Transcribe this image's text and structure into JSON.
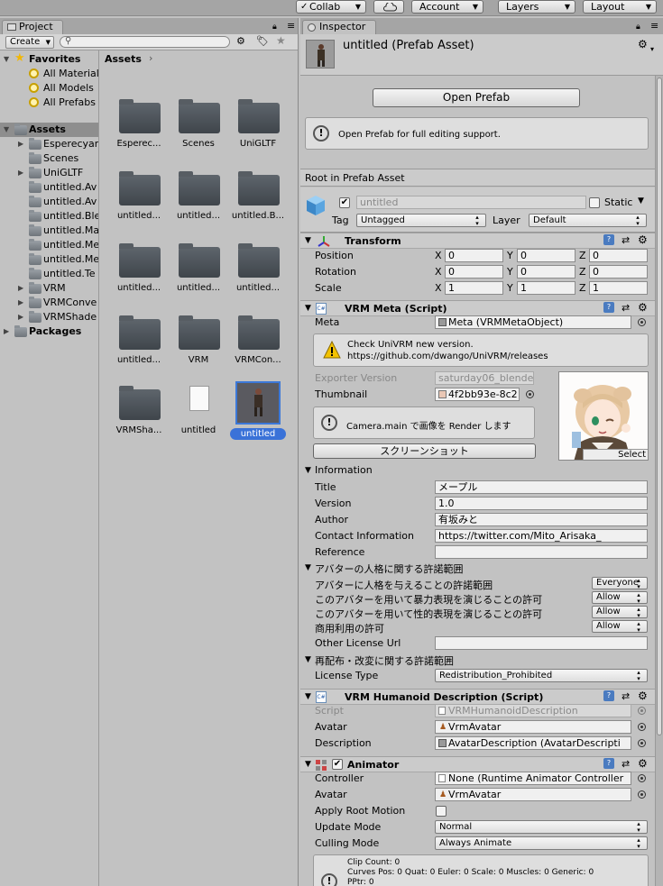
{
  "toolbar": {
    "collab": "Collab",
    "account": "Account",
    "layers": "Layers",
    "layout": "Layout"
  },
  "project": {
    "tab": "Project",
    "create": "Create",
    "breadcrumb": "Assets",
    "tree": [
      {
        "label": "Favorites",
        "bold": true,
        "level": 0,
        "icon": "star"
      },
      {
        "label": "All Materials",
        "level": 1,
        "icon": "search"
      },
      {
        "label": "All Models",
        "level": 1,
        "icon": "search"
      },
      {
        "label": "All Prefabs",
        "level": 1,
        "icon": "search"
      },
      {
        "label": "",
        "level": -1
      },
      {
        "label": "Assets",
        "bold": true,
        "level": 0,
        "icon": "folder",
        "selected": true
      },
      {
        "label": "Esperecyan",
        "level": 1,
        "icon": "folder",
        "arrow": true
      },
      {
        "label": "Scenes",
        "level": 1,
        "icon": "folder"
      },
      {
        "label": "UniGLTF",
        "level": 1,
        "icon": "folder",
        "arrow": true
      },
      {
        "label": "untitled.Av",
        "level": 1,
        "icon": "folder"
      },
      {
        "label": "untitled.Av",
        "level": 1,
        "icon": "folder"
      },
      {
        "label": "untitled.Ble",
        "level": 1,
        "icon": "folder"
      },
      {
        "label": "untitled.Ma",
        "level": 1,
        "icon": "folder"
      },
      {
        "label": "untitled.Me",
        "level": 1,
        "icon": "folder"
      },
      {
        "label": "untitled.Me",
        "level": 1,
        "icon": "folder"
      },
      {
        "label": "untitled.Te",
        "level": 1,
        "icon": "folder"
      },
      {
        "label": "VRM",
        "level": 1,
        "icon": "folder",
        "arrow": true
      },
      {
        "label": "VRMConve",
        "level": 1,
        "icon": "folder",
        "arrow": true
      },
      {
        "label": "VRMShade",
        "level": 1,
        "icon": "folder",
        "arrow": true
      },
      {
        "label": "Packages",
        "bold": true,
        "level": 0,
        "icon": "folder",
        "arrow": true
      }
    ],
    "grid": [
      {
        "label": "Esperec...",
        "type": "folder"
      },
      {
        "label": "Scenes",
        "type": "folder"
      },
      {
        "label": "UniGLTF",
        "type": "folder"
      },
      {
        "label": "untitled...",
        "type": "folder"
      },
      {
        "label": "untitled...",
        "type": "folder"
      },
      {
        "label": "untitled.B...",
        "type": "folder"
      },
      {
        "label": "untitled...",
        "type": "folder"
      },
      {
        "label": "untitled...",
        "type": "folder"
      },
      {
        "label": "untitled...",
        "type": "folder"
      },
      {
        "label": "untitled...",
        "type": "folder"
      },
      {
        "label": "VRM",
        "type": "folder"
      },
      {
        "label": "VRMCon...",
        "type": "folder"
      },
      {
        "label": "VRMSha...",
        "type": "folder"
      },
      {
        "label": "untitled",
        "type": "file"
      },
      {
        "label": "untitled",
        "type": "prefab",
        "selected": true
      }
    ]
  },
  "inspector": {
    "tab": "Inspector",
    "title": "untitled (Prefab Asset)",
    "open_prefab": "Open Prefab",
    "open_prefab_help": "Open Prefab for full editing support.",
    "root_label": "Root in Prefab Asset",
    "go_name": "untitled",
    "static": "Static",
    "tag_label": "Tag",
    "tag_value": "Untagged",
    "layer_label": "Layer",
    "layer_value": "Default",
    "transform": {
      "title": "Transform",
      "rows": [
        {
          "label": "Position",
          "x": "0",
          "y": "0",
          "z": "0"
        },
        {
          "label": "Rotation",
          "x": "0",
          "y": "0",
          "z": "0"
        },
        {
          "label": "Scale",
          "x": "1",
          "y": "1",
          "z": "1"
        }
      ]
    },
    "vrm_meta": {
      "title": "VRM Meta (Script)",
      "meta_label": "Meta",
      "meta_value": "Meta (VRMMetaObject)",
      "warning_line1": "Check UniVRM new version.",
      "warning_line2": "https://github.com/dwango/UniVRM/releases",
      "exporter_label": "Exporter Version",
      "exporter_value": "saturday06_blende",
      "thumbnail_label": "Thumbnail",
      "thumbnail_value": "4f2bb93e-8c2",
      "camera_help": "Camera.main で画像を Render します",
      "screenshot_button": "スクリーンショット",
      "select": "Select",
      "information": "Information",
      "info_rows": [
        {
          "label": "Title",
          "value": "メープル"
        },
        {
          "label": "Version",
          "value": "1.0"
        },
        {
          "label": "Author",
          "value": "有坂みと"
        },
        {
          "label": "Contact Information",
          "value": "https://twitter.com/Mito_Arisaka_"
        },
        {
          "label": "Reference",
          "value": ""
        }
      ],
      "persona_header": "アバターの人格に関する許諾範囲",
      "persona_rows": [
        {
          "label": "アバターに人格を与えることの許諾範囲",
          "value": "Everyone"
        },
        {
          "label": "このアバターを用いて暴力表現を演じることの許可",
          "value": "Allow"
        },
        {
          "label": "このアバターを用いて性的表現を演じることの許可",
          "value": "Allow"
        },
        {
          "label": "商用利用の許可",
          "value": "Allow"
        }
      ],
      "other_license_label": "Other License Url",
      "redistribution_header": "再配布・改変に関する許諾範囲",
      "license_type_label": "License Type",
      "license_type_value": "Redistribution_Prohibited"
    },
    "humanoid": {
      "title": "VRM Humanoid Description (Script)",
      "script_label": "Script",
      "script_value": "VRMHumanoidDescription",
      "avatar_label": "Avatar",
      "avatar_value": "VrmAvatar",
      "description_label": "Description",
      "description_value": "AvatarDescription (AvatarDescripti"
    },
    "animator": {
      "title": "Animator",
      "controller_label": "Controller",
      "controller_value": "None (Runtime Animator Controller",
      "avatar_label": "Avatar",
      "avatar_value": "VrmAvatar",
      "root_motion_label": "Apply Root Motion",
      "update_mode_label": "Update Mode",
      "update_mode_value": "Normal",
      "culling_label": "Culling Mode",
      "culling_value": "Always Animate",
      "info_line1": "Clip Count: 0",
      "info_line2": "Curves Pos: 0 Quat: 0 Euler: 0 Scale: 0 Muscles: 0 Generic: 0",
      "info_line3": "PPtr: 0"
    }
  }
}
